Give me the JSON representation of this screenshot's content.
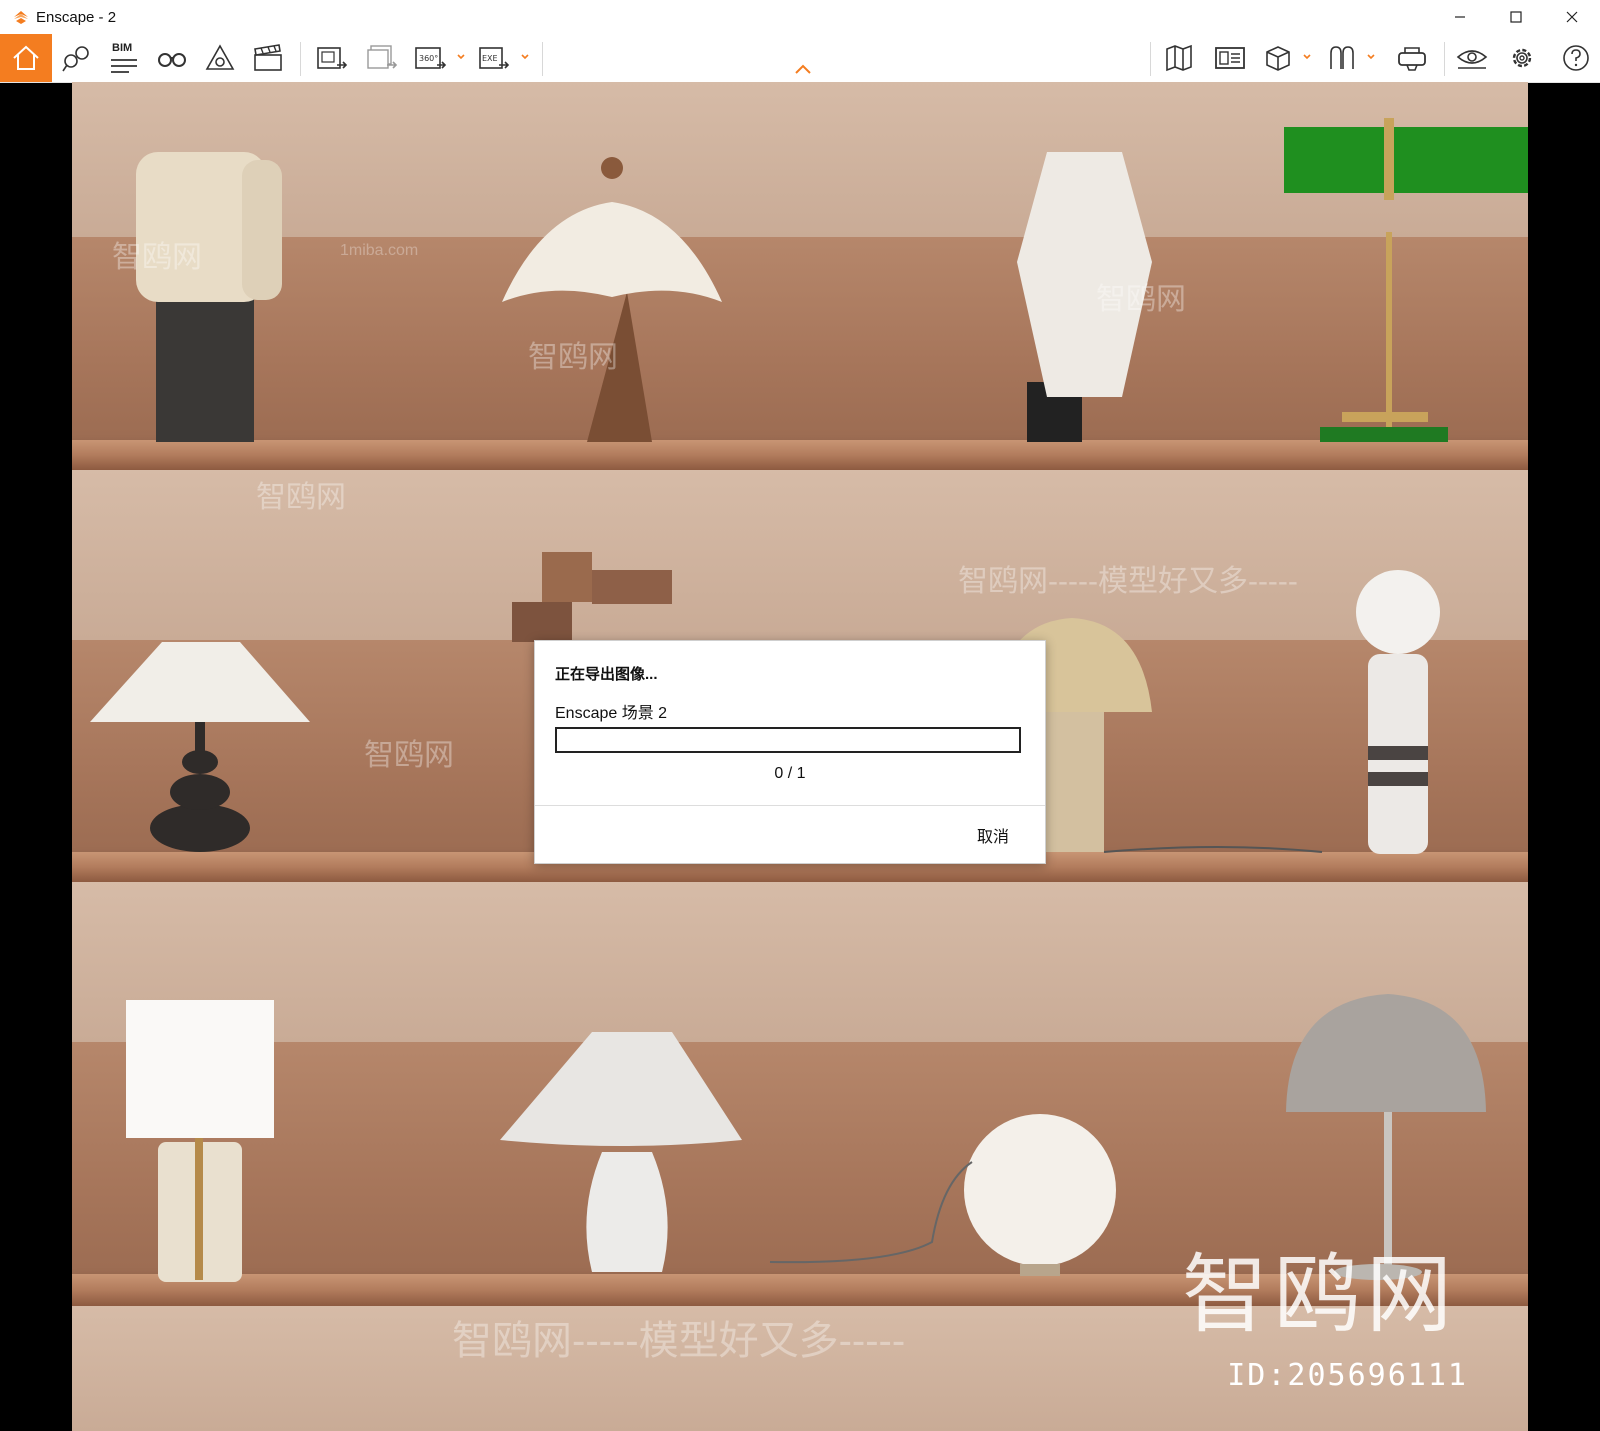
{
  "window": {
    "title": "Enscape - 2"
  },
  "toolbar": {
    "bim_label": "BIM",
    "icons": [
      "home-icon",
      "views-icon",
      "bim-info-icon",
      "binoculars-icon",
      "camera-perspective-icon",
      "video-editor-icon",
      "screenshot-export-icon",
      "batch-render-icon",
      "panorama-360-icon",
      "exe-export-icon",
      "map-icon",
      "asset-library-icon",
      "cube-icon",
      "vr-icon",
      "headset-icon",
      "visual-settings-icon",
      "settings-icon",
      "help-icon"
    ],
    "accent": "#f47d20"
  },
  "dialog": {
    "title": "正在导出图像...",
    "scene": "Enscape 场景 2",
    "progress": 0,
    "count": "0 / 1",
    "cancel": "取消"
  },
  "watermarks": {
    "site": "智鸥网",
    "slogan": "智鸥网-----模型好又多-----",
    "domain": "1miba.com",
    "brand": "智鸥网",
    "id": "ID:205696111"
  }
}
